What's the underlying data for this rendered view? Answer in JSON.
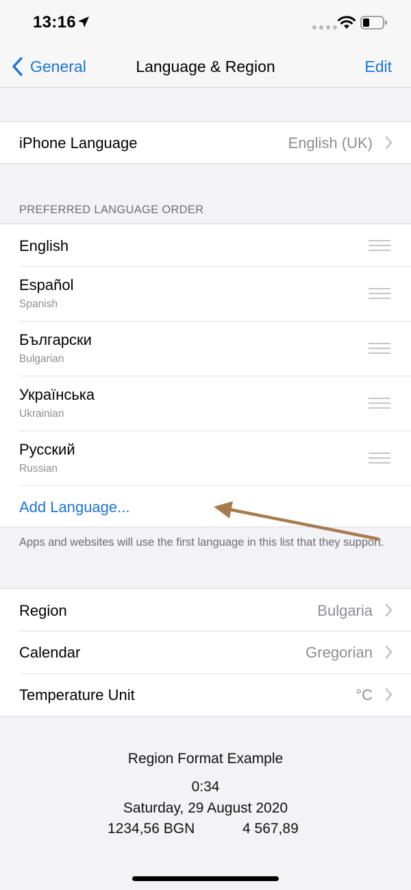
{
  "status_bar": {
    "time": "13:16",
    "icons": [
      "location-arrow-icon",
      "signal-dots-icon",
      "wifi-icon",
      "battery-icon"
    ]
  },
  "nav": {
    "back_label": "General",
    "title": "Language & Region",
    "edit_label": "Edit"
  },
  "iphone_language": {
    "label": "iPhone Language",
    "value": "English (UK)"
  },
  "preferred": {
    "header": "PREFERRED LANGUAGE ORDER",
    "languages": [
      {
        "name": "English",
        "subtitle": ""
      },
      {
        "name": "Español",
        "subtitle": "Spanish"
      },
      {
        "name": "Български",
        "subtitle": "Bulgarian"
      },
      {
        "name": "Українська",
        "subtitle": "Ukrainian"
      },
      {
        "name": "Русский",
        "subtitle": "Russian"
      }
    ],
    "add_label": "Add Language...",
    "footer": "Apps and websites will use the first language in this list that they support."
  },
  "region_settings": [
    {
      "label": "Region",
      "value": "Bulgaria"
    },
    {
      "label": "Calendar",
      "value": "Gregorian"
    },
    {
      "label": "Temperature Unit",
      "value": "°C"
    }
  ],
  "format_example": {
    "title": "Region Format Example",
    "time": "0:34",
    "date": "Saturday, 29 August 2020",
    "currency": "1234,56 BGN",
    "number": "4 567,89"
  },
  "colors": {
    "accent": "#1a73d9",
    "annotation_arrow": "#a67c4e",
    "background": "#f2f2f7"
  }
}
